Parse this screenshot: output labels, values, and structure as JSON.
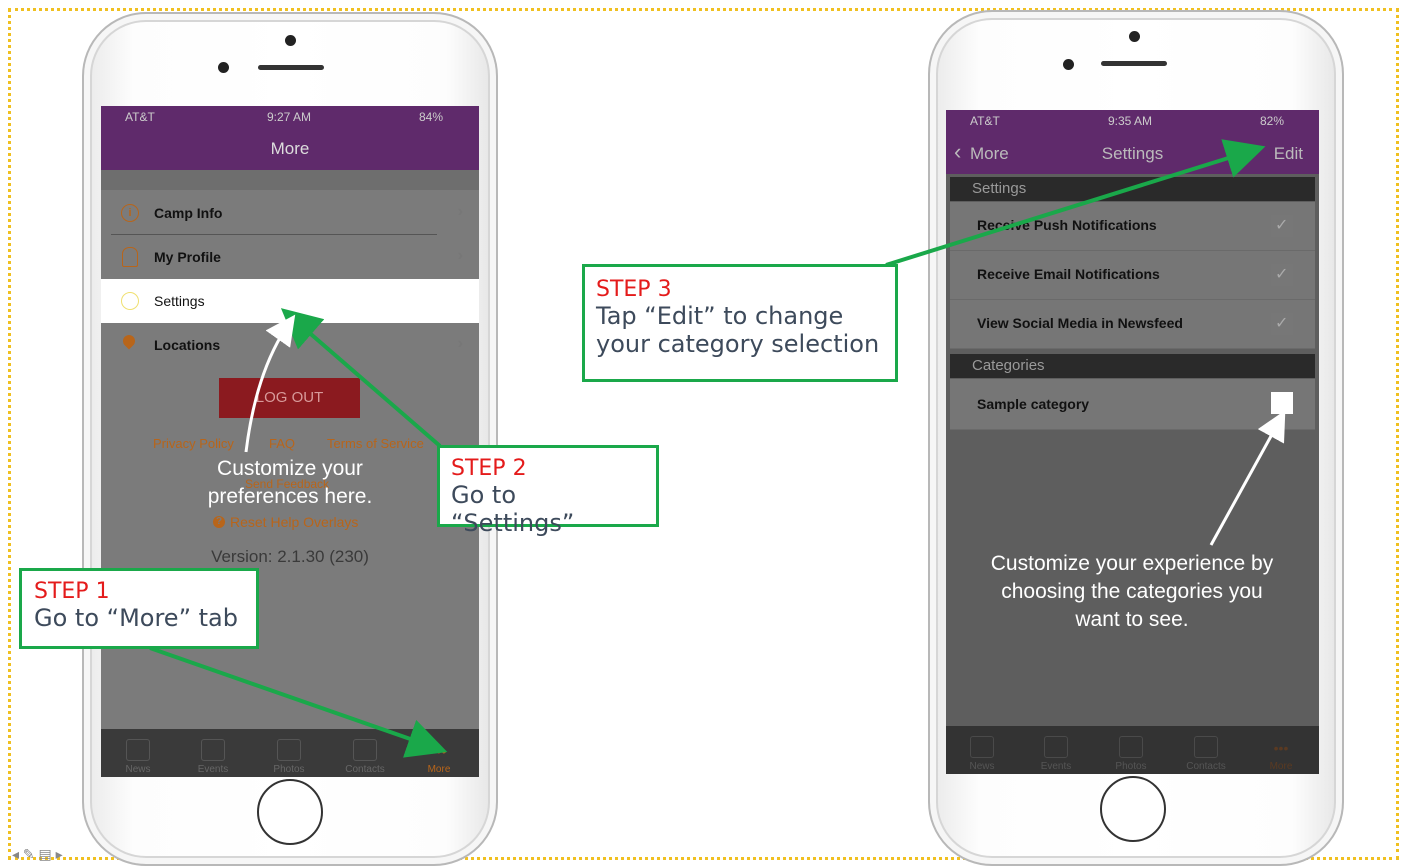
{
  "left_phone": {
    "status": {
      "carrier": "AT&T",
      "time": "9:27 AM",
      "battery": "84%"
    },
    "nav_title": "More",
    "menu": [
      {
        "label": "Camp Info",
        "icon": "info-icon"
      },
      {
        "label": "My Profile",
        "icon": "profile-icon"
      },
      {
        "label": "Settings",
        "icon": "gear-icon"
      },
      {
        "label": "Locations",
        "icon": "location-pin-icon"
      }
    ],
    "logout_label": "LOG OUT",
    "links": {
      "privacy": "Privacy Policy",
      "faq": "FAQ",
      "terms": "Terms of Service",
      "feedback": "Send Feedback",
      "reset": "Reset Help Overlays"
    },
    "version": "Version: 2.1.30 (230)",
    "overlay_text_line1": "Customize your",
    "overlay_text_line2": "preferences here.",
    "tabs": [
      "News",
      "Events",
      "Photos",
      "Contacts",
      "More"
    ]
  },
  "right_phone": {
    "status": {
      "carrier": "AT&T",
      "time": "9:35 AM",
      "battery": "82%"
    },
    "back_label": "More",
    "nav_title": "Settings",
    "edit_label": "Edit",
    "section_settings": "Settings",
    "settings_rows": [
      "Receive Push Notifications",
      "Receive Email Notifications",
      "View Social Media in Newsfeed"
    ],
    "section_categories": "Categories",
    "category_row": "Sample category",
    "overlay_text": [
      "Customize your experience by",
      "choosing the categories you",
      "want to see."
    ],
    "tabs": [
      "News",
      "Events",
      "Photos",
      "Contacts",
      "More"
    ]
  },
  "steps": {
    "step1": {
      "title": "STEP 1",
      "text": "Go to “More” tab"
    },
    "step2": {
      "title": "STEP 2",
      "text": "Go to “Settings”"
    },
    "step3": {
      "title": "STEP 3",
      "text_line1": "Tap “Edit” to change",
      "text_line2": "your category selection"
    }
  },
  "colors": {
    "accent_purple": "#5f2a6b",
    "arrow_green": "#1aa84a",
    "step_red": "#e41b1b",
    "link_orange": "#b8651a",
    "logout_red": "#8b1a1f",
    "frame_yellow": "#f0c020"
  }
}
